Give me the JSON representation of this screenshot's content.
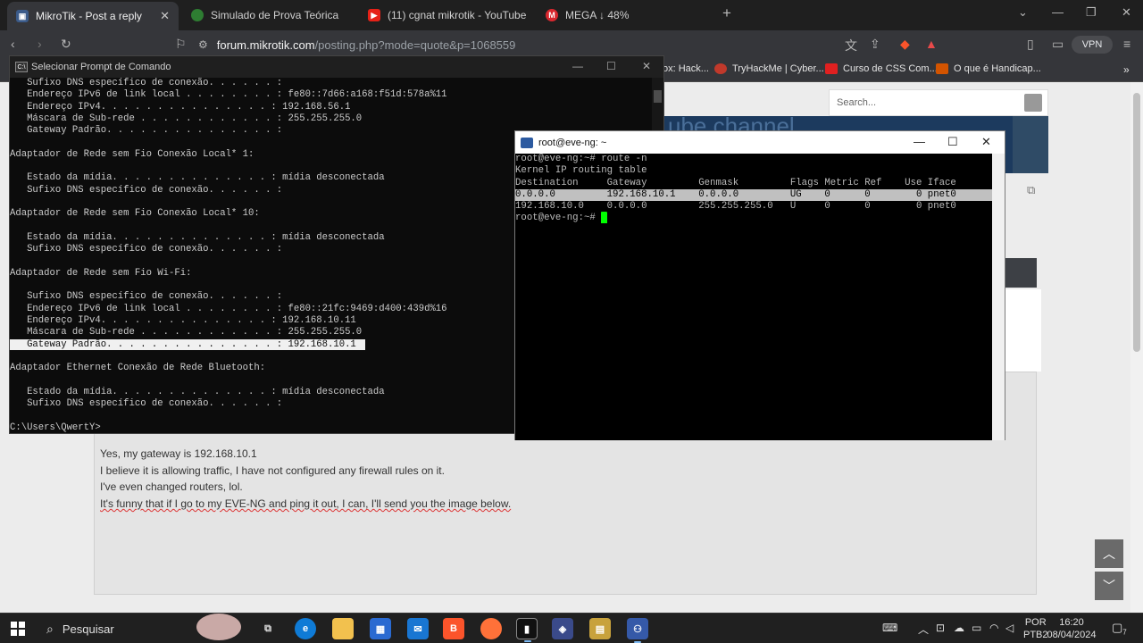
{
  "browser": {
    "tabs": [
      {
        "label": "MikroTik - Post a reply",
        "active": true
      },
      {
        "label": "Simulado de Prova Teórica",
        "active": false
      },
      {
        "label": "(11) cgnat mikrotik - YouTube",
        "active": false
      },
      {
        "label": "MEGA ↓ 48%",
        "active": false
      }
    ],
    "new_tab_glyph": "+",
    "url_host": "forum.mikrotik.com",
    "url_path": "/posting.php?mode=quote&p=1068559",
    "vpn_label": "VPN",
    "bookmarks": [
      {
        "label": "ox: Hack...",
        "color": "#444444"
      },
      {
        "label": "TryHackMe | Cyber...",
        "color": "#c0392b"
      },
      {
        "label": "Curso de CSS Com...",
        "color": "#e02020"
      },
      {
        "label": "O que é Handicap...",
        "color": "#d35400"
      }
    ]
  },
  "page": {
    "search_placeholder": "Search...",
    "banner_text": "ube channel",
    "reply_lines": [
      "Yes, my gateway is 192.168.10.1",
      "I believe it is allowing traffic, I have not configured any firewall rules on it.",
      "I've even changed routers, lol.",
      "It's funny that if I go to my EVE-NG and ping it out, I can, I'll send you the image below."
    ]
  },
  "cmd": {
    "title": "Selecionar Prompt de Comando",
    "lines": [
      "   Sufixo DNS específico de conexão. . . . . . :",
      "   Endereço IPv6 de link local . . . . . . . . : fe80::7d66:a168:f51d:578a%11",
      "   Endereço IPv4. . . . . . . . . . . . . . . : 192.168.56.1",
      "   Máscara de Sub-rede . . . . . . . . . . . . : 255.255.255.0",
      "   Gateway Padrão. . . . . . . . . . . . . . . :",
      "",
      "Adaptador de Rede sem Fio Conexão Local* 1:",
      "",
      "   Estado da mídia. . . . . . . . . . . . . . : mídia desconectada",
      "   Sufixo DNS específico de conexão. . . . . . :",
      "",
      "Adaptador de Rede sem Fio Conexão Local* 10:",
      "",
      "   Estado da mídia. . . . . . . . . . . . . . : mídia desconectada",
      "   Sufixo DNS específico de conexão. . . . . . :",
      "",
      "Adaptador de Rede sem Fio Wi-Fi:",
      "",
      "   Sufixo DNS específico de conexão. . . . . . :",
      "   Endereço IPv6 de link local . . . . . . . . : fe80::21fc:9469:d400:439d%16",
      "   Endereço IPv4. . . . . . . . . . . . . . . : 192.168.10.11",
      "   Máscara de Sub-rede . . . . . . . . . . . . : 255.255.255.0",
      "   Gateway Padrão. . . . . . . . . . . . . . . : 192.168.10.1",
      "",
      "Adaptador Ethernet Conexão de Rede Bluetooth:",
      "",
      "   Estado da mídia. . . . . . . . . . . . . . : mídia desconectada",
      "   Sufixo DNS específico de conexão. . . . . . :",
      "",
      "C:\\Users\\QwertY>"
    ],
    "highlighted_line_index": 22
  },
  "putty": {
    "title": "root@eve-ng: ~",
    "lines": [
      "root@eve-ng:~# route -n",
      "Kernel IP routing table",
      "Destination     Gateway         Genmask         Flags Metric Ref    Use Iface",
      "0.0.0.0         192.168.10.1    0.0.0.0         UG    0      0        0 pnet0",
      "192.168.10.0    0.0.0.0         255.255.255.0   U     0      0        0 pnet0",
      "root@eve-ng:~# "
    ],
    "selected_line_index": 3
  },
  "taskbar": {
    "search_label": "Pesquisar",
    "lang_line1": "POR",
    "lang_line2": "PTB2",
    "time": "16:20",
    "date": "08/04/2024",
    "notification_count": "7"
  }
}
